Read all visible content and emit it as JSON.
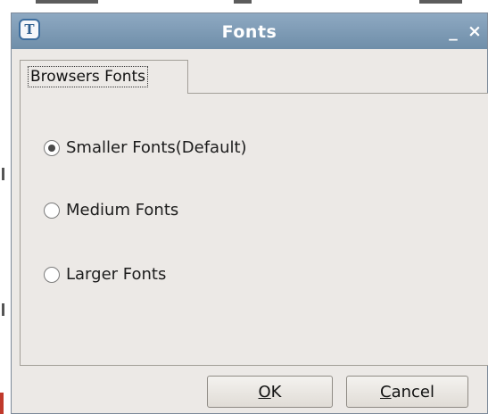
{
  "window": {
    "title": "Fonts",
    "minimize_glyph": "_",
    "close_glyph": "×",
    "app_icon_letter": "T"
  },
  "tabs": [
    {
      "label": "Browsers Fonts",
      "selected": true
    }
  ],
  "options": [
    {
      "label": "Smaller Fonts(Default)",
      "checked": true
    },
    {
      "label": "Medium Fonts",
      "checked": false
    },
    {
      "label": "Larger Fonts",
      "checked": false
    }
  ],
  "buttons": {
    "ok": {
      "mnemonic": "O",
      "rest": "K"
    },
    "cancel": {
      "mnemonic": "C",
      "rest": "ancel"
    }
  }
}
